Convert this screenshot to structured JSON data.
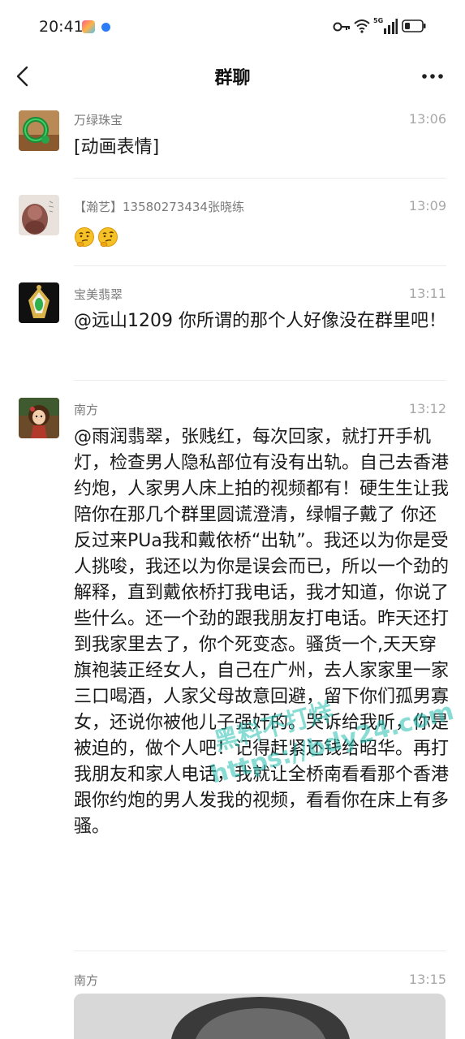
{
  "status_bar": {
    "time": "20:41",
    "network": "5G"
  },
  "header": {
    "title": "群聊"
  },
  "messages": [
    {
      "sender": "万绿珠宝",
      "time": "13:06",
      "text": "[动画表情]"
    },
    {
      "sender": "【瀚艺】13580273434张晓练",
      "time": "13:09",
      "emoji": [
        "thinking-face",
        "thinking-face"
      ]
    },
    {
      "sender": "宝美翡翠",
      "time": "13:11",
      "text": "@远山1209 你所谓的那个人好像没在群里吧！"
    },
    {
      "sender": "南方",
      "time": "13:12",
      "text": "@雨润翡翠，张贱红，每次回家，就打开手机灯，检查男人隐私部位有没有出轨。自己去香港约炮，人家男人床上拍的视频都有！硬生生让我陪你在那几个群里圆谎澄清，绿帽子戴了 你还反过来PUa我和戴依桥“出轨”。我还以为你是受人挑唆，我还以为你是误会而已，所以一个劲的解释，直到戴依桥打我电话，我才知道，你说了些什么。还一个劲的跟我朋友打电话。昨天还打到我家里去了，你个死变态。骚货一个,天天穿旗袍装正经女人，自己在广州，去人家家里一家三口喝酒，人家父母故意回避，留下你们孤男寡女，还说你被他儿子强奸的。哭诉给我听，你是被迫的，做个人吧！记得赶紧还钱给昭华。再打我朋友和家人电话，我就让全桥南看看那个香港跟你约炮的男人发我的视频，看看你在床上有多骚。"
    },
    {
      "sender": "南方",
      "time": "13:15"
    }
  ],
  "watermark": {
    "line1": "黑料不打烊",
    "line2": "https://bdy24.com"
  },
  "colors": {
    "background": "#ffffff",
    "sender_text": "#7a7a7a",
    "time_text": "#a8a8a8",
    "divider": "#ececec",
    "watermark": "#26c0b0"
  }
}
